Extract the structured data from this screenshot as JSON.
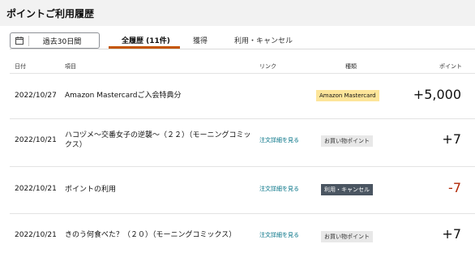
{
  "header": {
    "title": "ポイントご利用履歴"
  },
  "filter": {
    "date_range_label": "過去30日間"
  },
  "tabs": [
    {
      "label": "全履歴 (11件)",
      "active": true
    },
    {
      "label": "獲得",
      "active": false
    },
    {
      "label": "利用・キャンセル",
      "active": false
    }
  ],
  "columns": {
    "date": "日付",
    "item": "項目",
    "link": "リンク",
    "type": "種類",
    "points": "ポイント"
  },
  "rows": [
    {
      "date": "2022/10/27",
      "item": "Amazon Mastercardご入会特典分",
      "link": "",
      "type": "Amazon Mastercard",
      "points": "+5,000"
    },
    {
      "date": "2022/10/21",
      "item": "ハコヅメ～交番女子の逆襲～（２２）（モーニングコミックス）",
      "link": "注文詳細を見る",
      "type": "お買い物ポイント",
      "points": "+7"
    },
    {
      "date": "2022/10/21",
      "item": "ポイントの利用",
      "link": "注文詳細を見る",
      "type": "利用・キャンセル",
      "points": "-7"
    },
    {
      "date": "2022/10/21",
      "item": "きのう何食べた？（２０）（モーニングコミックス）",
      "link": "注文詳細を見る",
      "type": "お買い物ポイント",
      "points": "+7"
    }
  ],
  "colors": {
    "accent": "#c45500",
    "link": "#007185",
    "negative": "#b12704",
    "amazon_badge": "#fde59a",
    "use_badge": "#4a5561"
  }
}
